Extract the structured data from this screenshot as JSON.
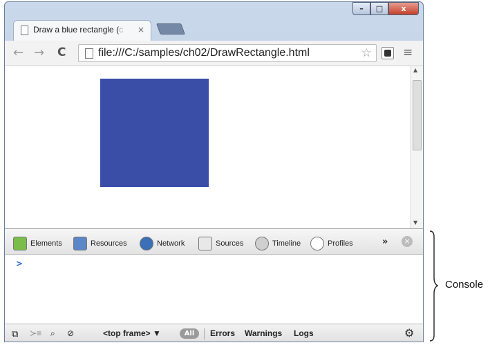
{
  "browser": {
    "tab_title": "Draw a blue rectangle (",
    "tab_title_faded": "c",
    "tab_close": "×",
    "url": "file:///C:/samples/ch02/DrawRectangle.html",
    "back_glyph": "←",
    "forward_glyph": "→",
    "reload_glyph": "C",
    "star_glyph": "☆",
    "menu_glyph": "≡",
    "window_buttons": {
      "minimize": "–",
      "maximize": "□",
      "close": "x"
    }
  },
  "page": {
    "rectangle_color": "#3a4ea8"
  },
  "devtools": {
    "tabs": [
      {
        "label": "Elements",
        "icon": "elements-icon",
        "color": "#7bbd4a"
      },
      {
        "label": "Resources",
        "icon": "resources-icon",
        "color": "#5b86c8"
      },
      {
        "label": "Network",
        "icon": "network-icon",
        "color": "#3b6fb6"
      },
      {
        "label": "Sources",
        "icon": "sources-icon",
        "color": "#e8e8e8"
      },
      {
        "label": "Timeline",
        "icon": "timeline-icon",
        "color": "#cfcfcf"
      },
      {
        "label": "Profiles",
        "icon": "profiles-icon",
        "color": "#ffffff"
      }
    ],
    "more_glyph": "»",
    "close_glyph": "×",
    "prompt": ">",
    "status": {
      "frame_select": "<top frame> ▼",
      "all_label": "All",
      "errors": "Errors",
      "warnings": "Warnings",
      "logs": "Logs"
    }
  },
  "annotation": {
    "label": "Console"
  }
}
